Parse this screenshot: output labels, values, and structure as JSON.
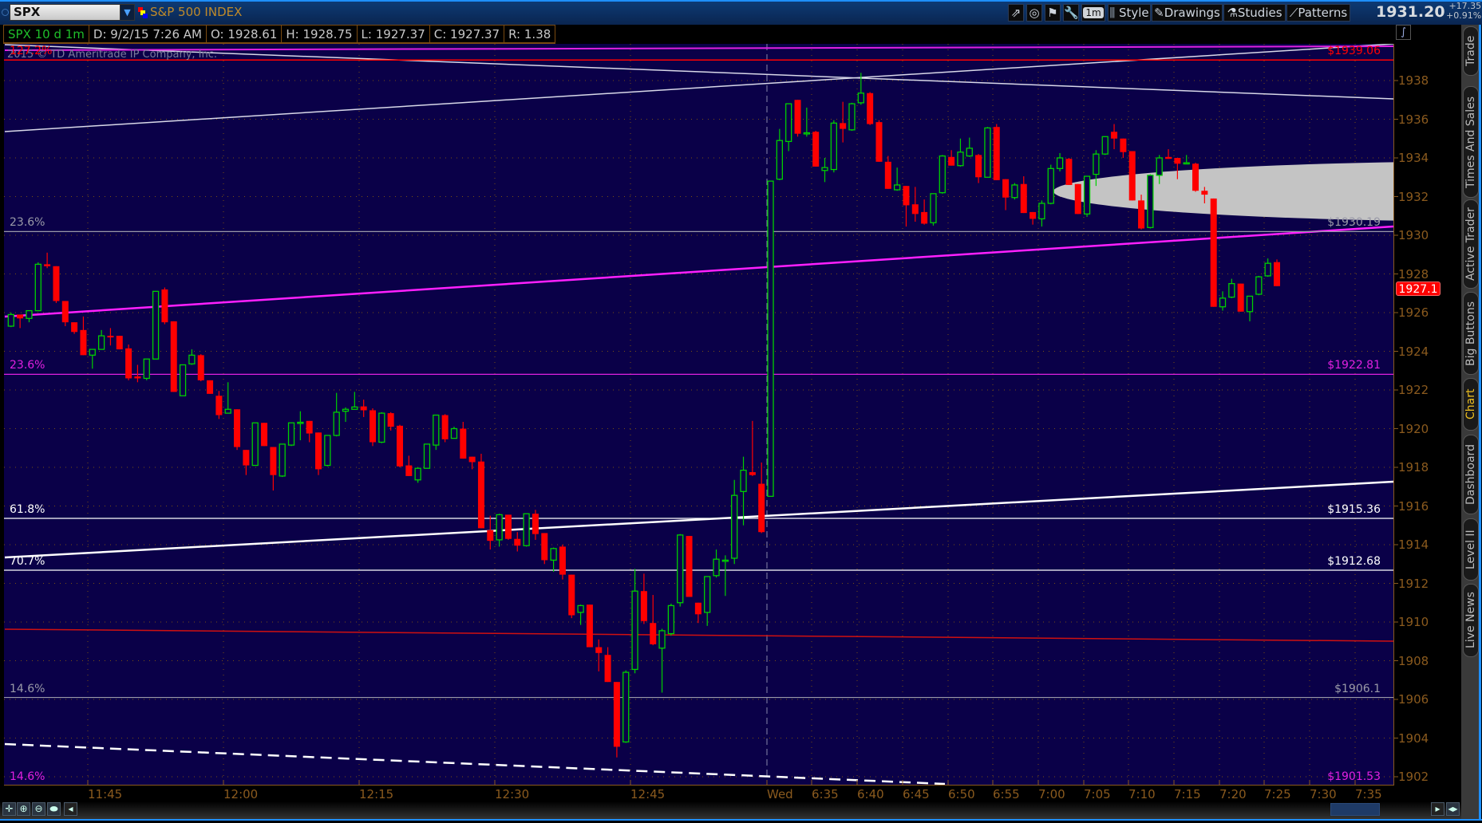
{
  "toolbar": {
    "symbol": "SPX",
    "symbol_name": "S&P 500 INDEX",
    "timeframe_button": "1m",
    "style_label": "Style",
    "drawings_label": "Drawings",
    "studies_label": "Studies",
    "patterns_label": "Patterns",
    "last_price": "1931.20",
    "net_change": "+17.35",
    "pct_change": "+0.91%"
  },
  "info": {
    "chart_desc": "SPX 10 d 1m",
    "date": "D: 9/2/15 7:26 AM",
    "open": "O: 1928.61",
    "high": "H: 1928.75",
    "low": "L: 1927.37",
    "close": "C: 1927.37",
    "range": "R: 1.38"
  },
  "copyright": "2015 © TD Ameritrade IP Company, Inc.",
  "current_price_tag": "1927.1",
  "side_tabs": [
    "Trade",
    "Times And Sales",
    "Active Trader",
    "Big Buttons",
    "Chart",
    "Dashboard",
    "Level II",
    "Live News"
  ],
  "active_tab": "Chart",
  "fib_levels": [
    {
      "pct": "127.2%",
      "price": 1939.06,
      "price_label": "$1939.06",
      "color": "#ff0000"
    },
    {
      "pct": "23.6%",
      "price": 1930.19,
      "price_label": "$1930.19",
      "color": "#9a9aa8"
    },
    {
      "pct": "23.6%",
      "price": 1922.81,
      "price_label": "$1922.81",
      "color": "#e020e0"
    },
    {
      "pct": "61.8%",
      "price": 1915.36,
      "price_label": "$1915.36",
      "color": "#ffffff"
    },
    {
      "pct": "70.7%",
      "price": 1912.68,
      "price_label": "$1912.68",
      "color": "#ffffff"
    },
    {
      "pct": "14.6%",
      "price": 1906.1,
      "price_label": "$1906.1",
      "color": "#9a9aa8"
    },
    {
      "pct": "14.6%",
      "price": 1901.53,
      "price_label": "$1901.53",
      "color": "#e020e0"
    }
  ],
  "colors": {
    "up": "#00d000",
    "down": "#ff0000",
    "background": "#0a0048",
    "axis": "#8a5a1e"
  },
  "chart_data": {
    "type": "candlestick",
    "title": "SPX 10 d 1m",
    "ylim": [
      1901.5,
      1940.2
    ],
    "y_ticks": [
      "1938",
      "1936",
      "1934",
      "1932",
      "1930",
      "1928",
      "1926",
      "1924",
      "1922",
      "1920",
      "1918",
      "1916",
      "1914",
      "1912",
      "1910",
      "1908",
      "1906",
      "1904",
      "1902"
    ],
    "x_ticks": [
      "11:45",
      "12:00",
      "12:15",
      "12:30",
      "12:45",
      "Wed",
      "6:35",
      "6:40",
      "6:45",
      "6:50",
      "6:55",
      "7:00",
      "7:05",
      "7:10",
      "7:15",
      "7:20",
      "7:25",
      "7:30",
      "7:35"
    ],
    "candles_ohlc": [
      [
        1925.3,
        1926.0,
        1925.25,
        1925.9
      ],
      [
        1925.9,
        1925.9,
        1925.2,
        1925.7
      ],
      [
        1925.7,
        1926.1,
        1925.5,
        1926.1
      ],
      [
        1926.1,
        1928.6,
        1926.1,
        1928.5
      ],
      [
        1928.5,
        1929.1,
        1928.3,
        1928.4
      ],
      [
        1928.4,
        1928.4,
        1926.5,
        1926.6
      ],
      [
        1926.6,
        1926.6,
        1925.3,
        1925.5
      ],
      [
        1925.5,
        1925.5,
        1924.9,
        1925.0
      ],
      [
        1925.1,
        1925.8,
        1923.8,
        1923.8
      ],
      [
        1923.8,
        1924.1,
        1923.1,
        1924.1
      ],
      [
        1924.1,
        1925.1,
        1924.1,
        1924.8
      ],
      [
        1924.8,
        1925.2,
        1924.3,
        1924.75
      ],
      [
        1924.8,
        1924.8,
        1924.1,
        1924.1
      ],
      [
        1924.15,
        1924.35,
        1922.5,
        1922.6
      ],
      [
        1922.7,
        1923.3,
        1922.4,
        1922.6
      ],
      [
        1922.6,
        1923.6,
        1922.5,
        1923.6
      ],
      [
        1923.6,
        1927.1,
        1923.6,
        1927.1
      ],
      [
        1927.2,
        1927.3,
        1925.4,
        1925.5
      ],
      [
        1925.55,
        1925.55,
        1921.9,
        1921.9
      ],
      [
        1921.7,
        1923.3,
        1921.7,
        1923.3
      ],
      [
        1923.35,
        1924.1,
        1923.3,
        1923.8
      ],
      [
        1923.8,
        1923.85,
        1922.45,
        1922.5
      ],
      [
        1922.5,
        1922.5,
        1921.8,
        1921.8
      ],
      [
        1921.7,
        1921.95,
        1920.5,
        1920.7
      ],
      [
        1920.8,
        1922.4,
        1920.8,
        1921.0
      ],
      [
        1921.0,
        1921.0,
        1918.9,
        1919.05
      ],
      [
        1918.9,
        1918.9,
        1917.6,
        1918.1
      ],
      [
        1918.1,
        1920.3,
        1918.1,
        1920.3
      ],
      [
        1920.3,
        1920.3,
        1919.1,
        1919.1
      ],
      [
        1919.05,
        1919.05,
        1916.8,
        1917.6
      ],
      [
        1917.55,
        1919.2,
        1917.5,
        1919.2
      ],
      [
        1919.15,
        1920.3,
        1919.1,
        1920.3
      ],
      [
        1920.3,
        1920.9,
        1919.4,
        1920.33
      ],
      [
        1920.4,
        1920.4,
        1919.3,
        1919.75
      ],
      [
        1919.8,
        1919.8,
        1917.6,
        1917.9
      ],
      [
        1918.1,
        1919.65,
        1918.05,
        1919.65
      ],
      [
        1919.65,
        1921.85,
        1919.6,
        1920.85
      ],
      [
        1920.9,
        1921.1,
        1920.35,
        1921.0
      ],
      [
        1921.0,
        1921.9,
        1921.0,
        1921.12
      ],
      [
        1921.15,
        1921.5,
        1920.6,
        1920.95
      ],
      [
        1920.95,
        1921.05,
        1919.1,
        1919.3
      ],
      [
        1919.3,
        1920.85,
        1919.25,
        1920.8
      ],
      [
        1920.8,
        1920.85,
        1919.9,
        1920.1
      ],
      [
        1920.15,
        1920.2,
        1918.0,
        1918.05
      ],
      [
        1918.1,
        1918.6,
        1917.55,
        1917.55
      ],
      [
        1917.35,
        1918.0,
        1917.2,
        1917.95
      ],
      [
        1917.95,
        1919.2,
        1917.95,
        1919.2
      ],
      [
        1919.15,
        1920.7,
        1918.9,
        1920.7
      ],
      [
        1920.7,
        1920.75,
        1919.3,
        1919.45
      ],
      [
        1919.5,
        1920.1,
        1919.5,
        1920.0
      ],
      [
        1920.0,
        1920.35,
        1918.45,
        1918.45
      ],
      [
        1918.55,
        1918.55,
        1917.9,
        1918.27
      ],
      [
        1918.3,
        1918.7,
        1914.85,
        1914.85
      ],
      [
        1914.75,
        1915.5,
        1913.75,
        1914.2
      ],
      [
        1914.25,
        1915.6,
        1913.9,
        1915.55
      ],
      [
        1915.55,
        1915.55,
        1914.25,
        1914.3
      ],
      [
        1914.3,
        1914.65,
        1913.65,
        1913.95
      ],
      [
        1913.95,
        1915.6,
        1913.9,
        1915.6
      ],
      [
        1915.6,
        1915.8,
        1914.25,
        1914.55
      ],
      [
        1914.6,
        1914.6,
        1913.0,
        1913.2
      ],
      [
        1913.2,
        1913.85,
        1912.6,
        1913.8
      ],
      [
        1913.9,
        1914.0,
        1912.2,
        1912.45
      ],
      [
        1912.45,
        1912.45,
        1910.2,
        1910.35
      ],
      [
        1910.5,
        1910.9,
        1909.85,
        1910.85
      ],
      [
        1910.9,
        1910.9,
        1908.7,
        1908.7
      ],
      [
        1908.7,
        1909.1,
        1907.45,
        1908.4
      ],
      [
        1908.3,
        1908.7,
        1906.9,
        1906.9
      ],
      [
        1906.9,
        1906.9,
        1903.0,
        1903.55
      ],
      [
        1903.8,
        1907.5,
        1903.75,
        1907.4
      ],
      [
        1907.55,
        1912.75,
        1907.35,
        1911.6
      ],
      [
        1911.6,
        1912.5,
        1909.9,
        1910.05
      ],
      [
        1909.95,
        1911.4,
        1908.8,
        1908.85
      ],
      [
        1908.65,
        1909.65,
        1906.35,
        1909.55
      ],
      [
        1909.4,
        1910.95,
        1909.3,
        1910.85
      ],
      [
        1911.0,
        1914.55,
        1910.8,
        1914.5
      ],
      [
        1914.45,
        1914.45,
        1911.3,
        1911.3
      ],
      [
        1911.0,
        1911.0,
        1909.95,
        1910.4
      ],
      [
        1910.5,
        1912.35,
        1909.8,
        1912.35
      ],
      [
        1912.4,
        1913.75,
        1912.3,
        1913.25
      ],
      [
        1913.2,
        1913.45,
        1911.35,
        1913.2
      ],
      [
        1913.3,
        1917.35,
        1913.0,
        1916.55
      ],
      [
        1916.75,
        1918.55,
        1915.0,
        1917.85
      ],
      [
        1917.75,
        1920.4,
        1917.55,
        1917.6
      ],
      [
        1917.15,
        1918.25,
        1914.6,
        1914.65
      ],
      [
        1916.5,
        1932.8,
        1916.5,
        1932.8
      ],
      [
        1932.9,
        1935.5,
        1932.85,
        1934.9
      ],
      [
        1934.85,
        1936.8,
        1934.35,
        1936.8
      ],
      [
        1937.0,
        1937.0,
        1935.1,
        1935.25
      ],
      [
        1935.28,
        1936.6,
        1935.1,
        1935.3
      ],
      [
        1935.35,
        1935.4,
        1933.55,
        1933.55
      ],
      [
        1933.35,
        1934.0,
        1932.75,
        1933.5
      ],
      [
        1933.4,
        1935.95,
        1933.25,
        1935.8
      ],
      [
        1935.8,
        1936.9,
        1934.8,
        1935.5
      ],
      [
        1935.45,
        1936.85,
        1935.4,
        1936.8
      ],
      [
        1936.85,
        1938.4,
        1936.75,
        1937.35
      ],
      [
        1937.35,
        1937.4,
        1935.7,
        1935.75
      ],
      [
        1935.85,
        1935.95,
        1933.8,
        1933.8
      ],
      [
        1933.8,
        1934.1,
        1932.4,
        1932.4
      ],
      [
        1932.35,
        1933.5,
        1932.3,
        1932.6
      ],
      [
        1932.55,
        1932.55,
        1930.45,
        1931.55
      ],
      [
        1931.6,
        1932.5,
        1930.7,
        1931.1
      ],
      [
        1931.2,
        1931.85,
        1930.55,
        1930.6
      ],
      [
        1930.65,
        1932.15,
        1930.5,
        1932.15
      ],
      [
        1932.2,
        1934.15,
        1932.15,
        1934.1
      ],
      [
        1934.05,
        1934.4,
        1933.6,
        1933.6
      ],
      [
        1933.6,
        1935.0,
        1933.55,
        1934.3
      ],
      [
        1934.1,
        1935.05,
        1934.05,
        1934.5
      ],
      [
        1934.15,
        1934.2,
        1932.7,
        1933.0
      ],
      [
        1933.0,
        1935.6,
        1933.0,
        1935.55
      ],
      [
        1935.6,
        1935.75,
        1932.85,
        1932.85
      ],
      [
        1932.9,
        1932.9,
        1931.3,
        1931.95
      ],
      [
        1931.95,
        1932.7,
        1931.85,
        1932.6
      ],
      [
        1932.65,
        1933.05,
        1931.15,
        1931.15
      ],
      [
        1931.2,
        1931.2,
        1930.55,
        1930.85
      ],
      [
        1930.85,
        1931.8,
        1930.45,
        1931.65
      ],
      [
        1931.65,
        1933.65,
        1931.6,
        1933.45
      ],
      [
        1933.45,
        1934.25,
        1933.3,
        1934.0
      ],
      [
        1933.95,
        1934.0,
        1932.6,
        1932.6
      ],
      [
        1932.65,
        1932.65,
        1931.1,
        1931.1
      ],
      [
        1931.1,
        1933.05,
        1930.95,
        1933.05
      ],
      [
        1933.15,
        1934.4,
        1932.55,
        1934.2
      ],
      [
        1934.2,
        1935.1,
        1934.15,
        1935.1
      ],
      [
        1935.35,
        1935.75,
        1934.45,
        1935.0
      ],
      [
        1935.0,
        1935.0,
        1934.0,
        1934.3
      ],
      [
        1934.35,
        1934.35,
        1931.8,
        1931.8
      ],
      [
        1931.8,
        1932.1,
        1930.3,
        1930.35
      ],
      [
        1930.4,
        1933.15,
        1930.35,
        1933.1
      ],
      [
        1933.1,
        1934.15,
        1932.65,
        1934.0
      ],
      [
        1934.05,
        1934.45,
        1933.95,
        1933.95
      ],
      [
        1934.0,
        1934.0,
        1932.9,
        1933.7
      ],
      [
        1933.7,
        1934.15,
        1933.7,
        1933.75
      ],
      [
        1933.7,
        1933.75,
        1932.25,
        1932.3
      ],
      [
        1932.3,
        1932.5,
        1931.65,
        1932.1
      ],
      [
        1931.9,
        1931.9,
        1926.3,
        1926.3
      ],
      [
        1926.3,
        1927.1,
        1926.1,
        1926.75
      ],
      [
        1926.8,
        1927.75,
        1926.75,
        1927.5
      ],
      [
        1927.5,
        1927.5,
        1926.05,
        1926.05
      ],
      [
        1926.05,
        1926.85,
        1925.55,
        1926.85
      ],
      [
        1926.95,
        1927.9,
        1926.9,
        1927.85
      ],
      [
        1927.9,
        1928.8,
        1927.85,
        1928.55
      ],
      [
        1928.61,
        1928.75,
        1927.37,
        1927.37
      ]
    ]
  }
}
